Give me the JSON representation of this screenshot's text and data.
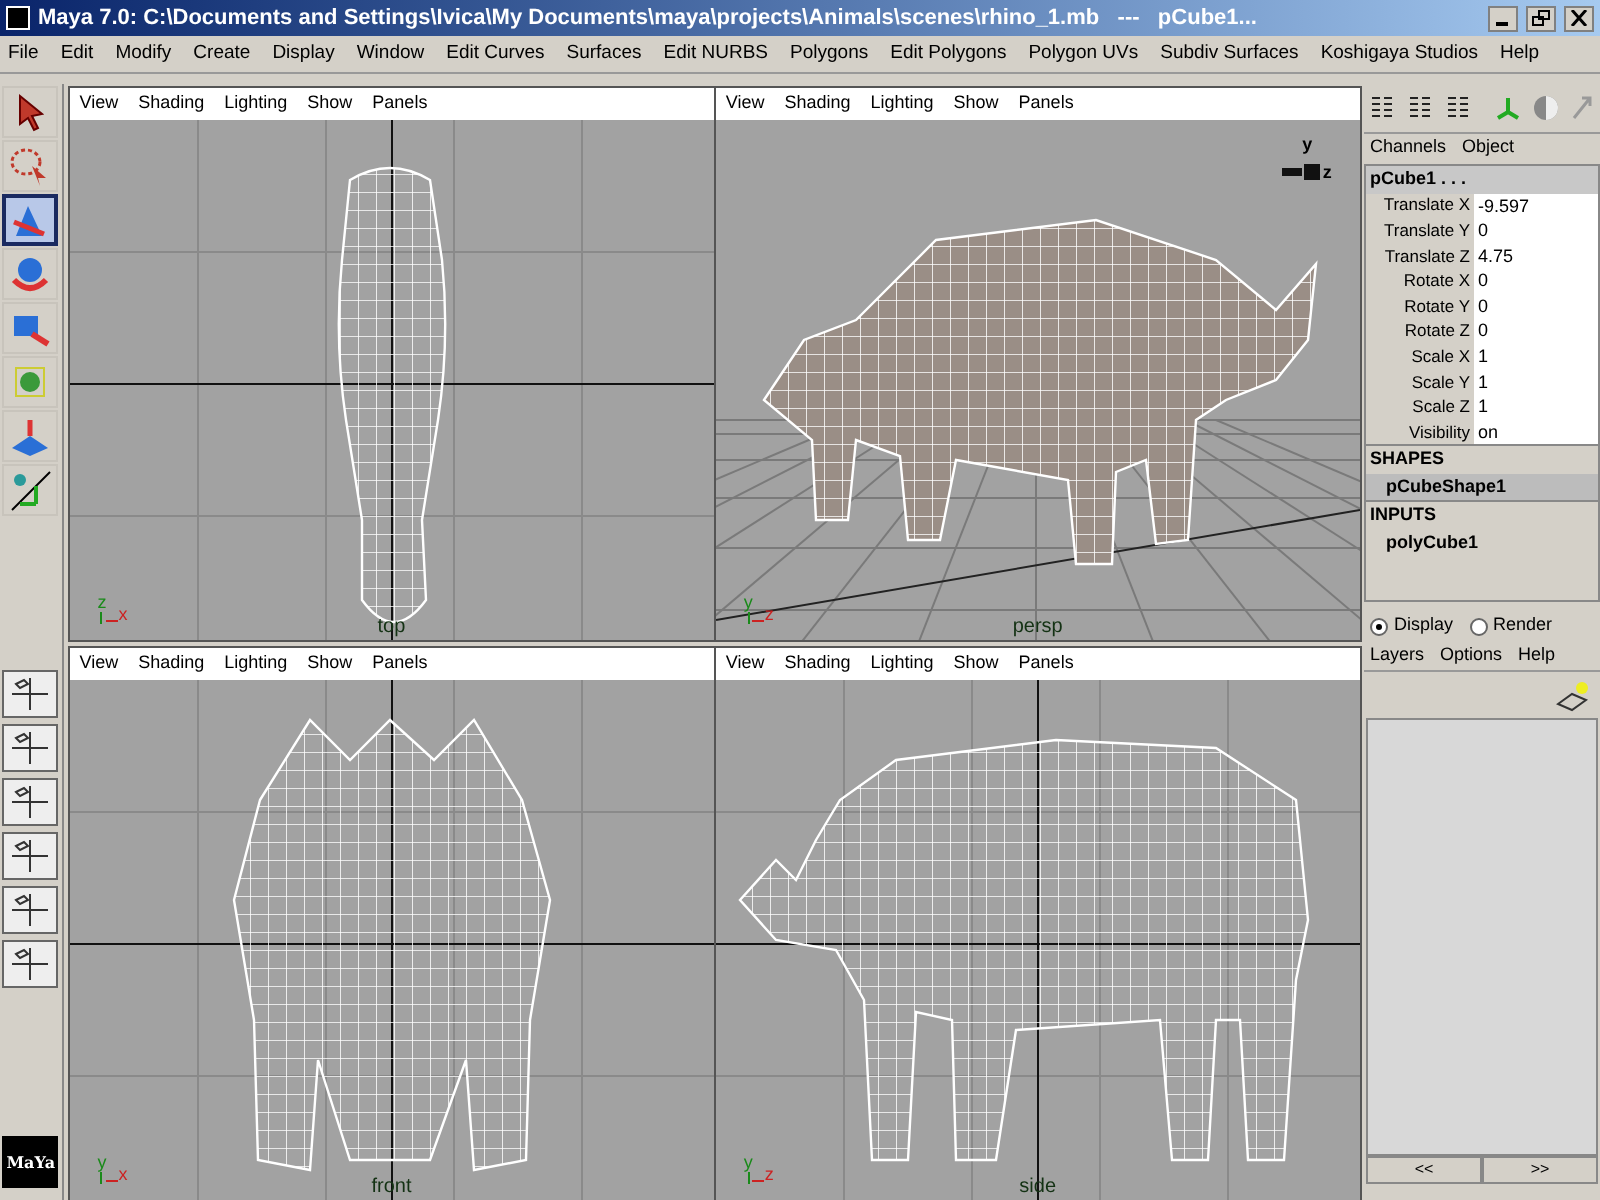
{
  "window": {
    "title": "Maya 7.0: C:\\Documents and Settings\\Ivica\\My Documents\\maya\\projects\\Animals\\scenes\\rhino_1.mb   ---   pCube1..."
  },
  "menu": [
    "File",
    "Edit",
    "Modify",
    "Create",
    "Display",
    "Window",
    "Edit Curves",
    "Surfaces",
    "Edit NURBS",
    "Polygons",
    "Edit Polygons",
    "Polygon UVs",
    "Subdiv Surfaces",
    "Koshigaya Studios",
    "Help"
  ],
  "tools": [
    {
      "kind": "select",
      "selected": false
    },
    {
      "kind": "lasso",
      "selected": false
    },
    {
      "kind": "move",
      "selected": true
    },
    {
      "kind": "rotate",
      "selected": false
    },
    {
      "kind": "scale",
      "selected": false
    },
    {
      "kind": "universal",
      "selected": false
    },
    {
      "kind": "soft",
      "selected": false
    },
    {
      "kind": "manip",
      "selected": false
    }
  ],
  "logo": "MaYa",
  "viewports": [
    {
      "kind": "top",
      "menu": [
        "View",
        "Shading",
        "Lighting",
        "Show",
        "Panels"
      ],
      "label": "top",
      "axes": [
        "z",
        "x"
      ]
    },
    {
      "kind": "persp",
      "menu": [
        "View",
        "Shading",
        "Lighting",
        "Show",
        "Panels"
      ],
      "label": "persp",
      "axes": [
        "y",
        "z"
      ],
      "view_cube": [
        "y",
        "z"
      ]
    },
    {
      "kind": "front",
      "menu": [
        "View",
        "Shading",
        "Lighting",
        "Show",
        "Panels"
      ],
      "label": "front",
      "axes": [
        "y",
        "x"
      ]
    },
    {
      "kind": "side",
      "menu": [
        "View",
        "Shading",
        "Lighting",
        "Show",
        "Panels"
      ],
      "label": "side",
      "axes": [
        "y",
        "z"
      ]
    }
  ],
  "channel_box": {
    "menu": [
      "Channels",
      "Object"
    ],
    "object": "pCube1 . . .",
    "attributes": [
      {
        "name": "Translate X",
        "value": "-9.597"
      },
      {
        "name": "Translate Y",
        "value": "0"
      },
      {
        "name": "Translate Z",
        "value": "4.75"
      },
      {
        "name": "Rotate X",
        "value": "0"
      },
      {
        "name": "Rotate Y",
        "value": "0"
      },
      {
        "name": "Rotate Z",
        "value": "0"
      },
      {
        "name": "Scale X",
        "value": "1"
      },
      {
        "name": "Scale Y",
        "value": "1"
      },
      {
        "name": "Scale Z",
        "value": "1"
      },
      {
        "name": "Visibility",
        "value": "on"
      }
    ],
    "shapes_header": "SHAPES",
    "shapes": [
      {
        "name": "pCubeShape1",
        "selected": true
      }
    ],
    "inputs_header": "INPUTS",
    "inputs": [
      {
        "name": "polyCube1",
        "selected": false
      }
    ]
  },
  "layer_editor": {
    "modes": [
      {
        "label": "Display",
        "selected": true
      },
      {
        "label": "Render",
        "selected": false
      }
    ],
    "menu": [
      "Layers",
      "Options",
      "Help"
    ],
    "buttons": [
      "<<",
      ">>"
    ]
  }
}
